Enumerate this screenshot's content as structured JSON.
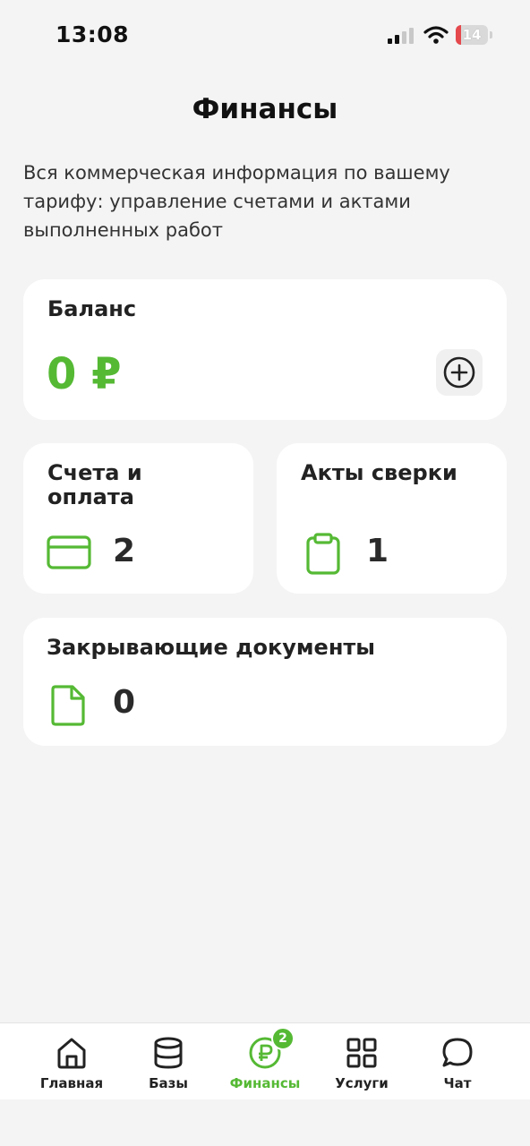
{
  "status_bar": {
    "time": "13:08",
    "battery_level": "14",
    "icons": [
      "signal-icon",
      "wifi-icon",
      "battery-icon"
    ]
  },
  "header": {
    "title": "Финансы"
  },
  "description": "Вся коммерческая информация по вашему тарифу: управление счетами и актами выполненных работ",
  "colors": {
    "accent": "#55b934",
    "background": "#f4f4f4",
    "card": "#ffffff",
    "battery_low": "#e5484d"
  },
  "balance": {
    "title": "Баланс",
    "value": "0 ₽",
    "add_icon": "plus-circle-icon"
  },
  "invoices": {
    "title": "Счета и оплата",
    "count": "2",
    "icon": "credit-card-icon"
  },
  "acts": {
    "title": "Акты сверки",
    "count": "1",
    "icon": "clipboard-icon"
  },
  "closing_docs": {
    "title": "Закрывающие документы",
    "count": "0",
    "icon": "document-icon"
  },
  "tabs": [
    {
      "label": "Главная",
      "icon": "home-icon",
      "active": false
    },
    {
      "label": "Базы",
      "icon": "database-icon",
      "active": false
    },
    {
      "label": "Финансы",
      "icon": "ruble-icon",
      "active": true,
      "badge": "2"
    },
    {
      "label": "Услуги",
      "icon": "grid-icon",
      "active": false
    },
    {
      "label": "Чат",
      "icon": "chat-icon",
      "active": false
    }
  ]
}
